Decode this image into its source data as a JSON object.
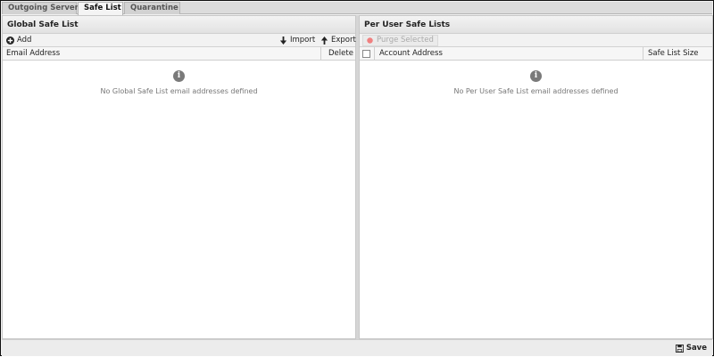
{
  "tabs": [
    {
      "label": "Outgoing Server"
    },
    {
      "label": "Safe List"
    },
    {
      "label": "Quarantine"
    }
  ],
  "global": {
    "title": "Global Safe List",
    "toolbar": {
      "add": "Add",
      "import": "Import",
      "export": "Export"
    },
    "columns": {
      "email": "Email Address",
      "delete": "Delete"
    },
    "empty_text": "No Global Safe List email addresses defined"
  },
  "per_user": {
    "title": "Per User Safe Lists",
    "toolbar": {
      "purge": "Purge Selected"
    },
    "columns": {
      "account": "Account Address",
      "size": "Safe List Size"
    },
    "empty_text": "No Per User Safe List email addresses defined"
  },
  "footer": {
    "save": "Save"
  },
  "colors": {
    "purge_dot": "#f08080",
    "info_icon": "#7a7a7a"
  }
}
